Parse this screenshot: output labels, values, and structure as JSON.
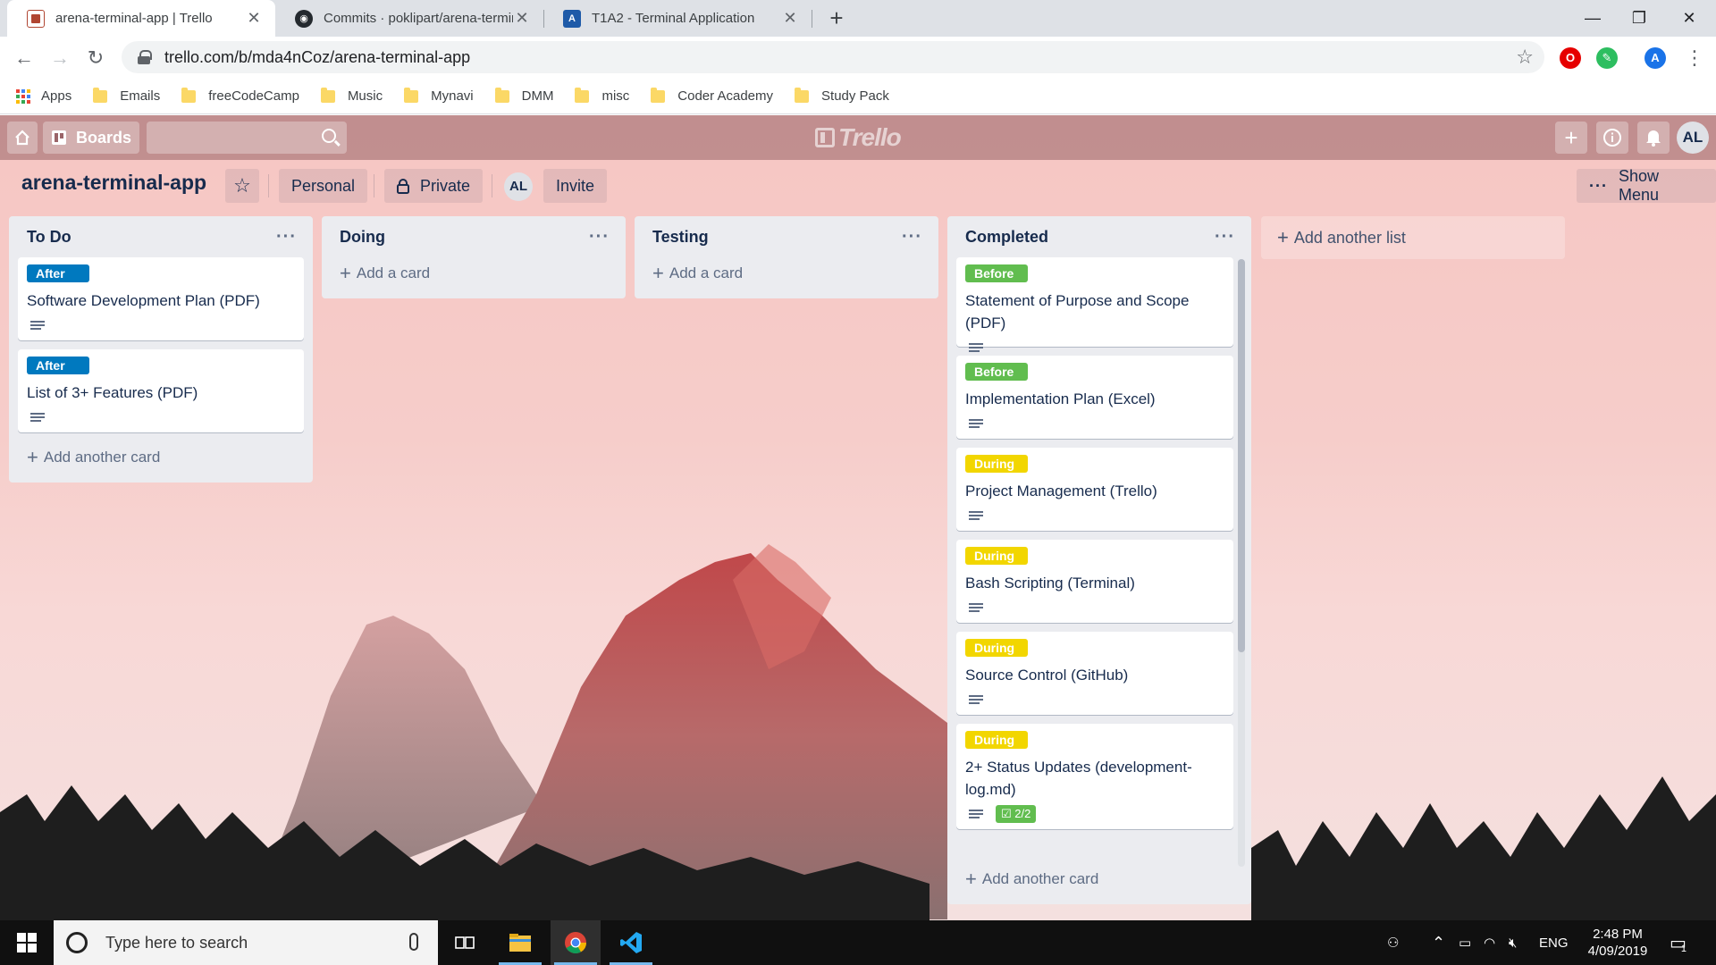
{
  "browser": {
    "tabs": [
      {
        "title": "arena-terminal-app | Trello",
        "active": true
      },
      {
        "title": "Commits · poklipart/arena-termin",
        "active": false
      },
      {
        "title": "T1A2 - Terminal Application",
        "active": false
      }
    ],
    "url": "trello.com/b/mda4nCoz/arena-terminal-app",
    "profile_initial": "A",
    "bookmarks": [
      "Apps",
      "Emails",
      "freeCodeCamp",
      "Music",
      "Mynavi",
      "DMM",
      "misc",
      "Coder Academy",
      "Study Pack"
    ]
  },
  "trello": {
    "header": {
      "boards_label": "Boards",
      "logo_text": "Trello",
      "user_initials": "AL"
    },
    "board": {
      "name": "arena-terminal-app",
      "team_label": "Personal",
      "visibility_label": "Private",
      "member_initials": "AL",
      "invite_label": "Invite",
      "show_menu_label": "Show Menu"
    },
    "lists": [
      {
        "title": "To Do",
        "add_label": "Add another card",
        "cards": [
          {
            "label": "After",
            "label_color": "#0079bf",
            "title": "Software Development Plan (PDF)",
            "has_description": true
          },
          {
            "label": "After",
            "label_color": "#0079bf",
            "title": "List of 3+ Features (PDF)",
            "has_description": true
          }
        ]
      },
      {
        "title": "Doing",
        "add_label": "Add a card",
        "cards": []
      },
      {
        "title": "Testing",
        "add_label": "Add a card",
        "cards": []
      },
      {
        "title": "Completed",
        "add_label": "Add another card",
        "cards": [
          {
            "label": "Before",
            "label_color": "#61bd4f",
            "title": "Statement of Purpose and Scope (PDF)",
            "has_description": true
          },
          {
            "label": "Before",
            "label_color": "#61bd4f",
            "title": "Implementation Plan (Excel)",
            "has_description": true
          },
          {
            "label": "During",
            "label_color": "#f2d600",
            "title": "Project Management (Trello)",
            "has_description": true
          },
          {
            "label": "During",
            "label_color": "#f2d600",
            "title": "Bash Scripting (Terminal)",
            "has_description": true
          },
          {
            "label": "During",
            "label_color": "#f2d600",
            "title": "Source Control (GitHub)",
            "has_description": true
          },
          {
            "label": "During",
            "label_color": "#f2d600",
            "title": "2+ Status Updates (development-log.md)",
            "has_description": true,
            "checklist": "2/2"
          }
        ]
      }
    ],
    "add_list_label": "Add another list"
  },
  "taskbar": {
    "search_placeholder": "Type here to search",
    "language": "ENG",
    "time": "2:48 PM",
    "date": "4/09/2019",
    "notification_count": "1"
  }
}
